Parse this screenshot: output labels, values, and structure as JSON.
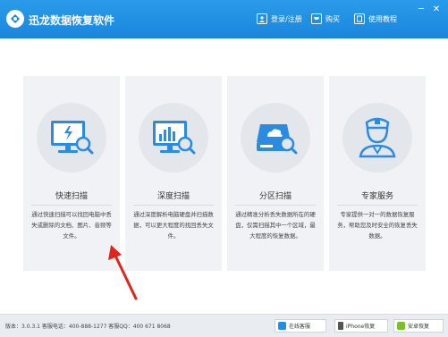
{
  "app": {
    "title": "迅龙数据恢复软件"
  },
  "toolbar": {
    "login_label": "登录/注册",
    "buy_label": "购买",
    "tutorial_label": "使用教程"
  },
  "window_controls": {
    "minimize": "─",
    "close": "✕"
  },
  "cards": [
    {
      "title": "快速扫描",
      "desc": "通过快速扫描可以找回电脑中丢失或删除的文档、图片、音频等文件。",
      "icon": "monitor-search-icon"
    },
    {
      "title": "深度扫描",
      "desc": "通过深度解析电脑硬盘并扫描数据，可以更大程度的找回丢失文件。",
      "icon": "chart-search-icon"
    },
    {
      "title": "分区扫描",
      "desc": "通过精准分析丢失数据所在的硬盘，仅需扫描其中一个区域，最大程度的恢复数据。",
      "icon": "disk-search-icon"
    },
    {
      "title": "专家服务",
      "desc": "专家提供一对一的数据恢复服务，帮助您及时安全的恢复丢失数据。",
      "icon": "expert-icon"
    }
  ],
  "status": {
    "text": "版本：3.0.3.1  客服电话：400-888-1277  客服QQ：400 671 8068"
  },
  "bottom_buttons": [
    {
      "label": "在线客服",
      "icon": "qq-icon",
      "color": "#1f8fe0"
    },
    {
      "label": "iPhone恢复",
      "icon": "iphone-icon",
      "color": "#555555"
    },
    {
      "label": "安卓恢复",
      "icon": "android-icon",
      "color": "#7cbf2a"
    }
  ],
  "colors": {
    "accent": "#1a86dc",
    "icon_blue": "#2b8be0",
    "arrow": "#e0251e"
  }
}
